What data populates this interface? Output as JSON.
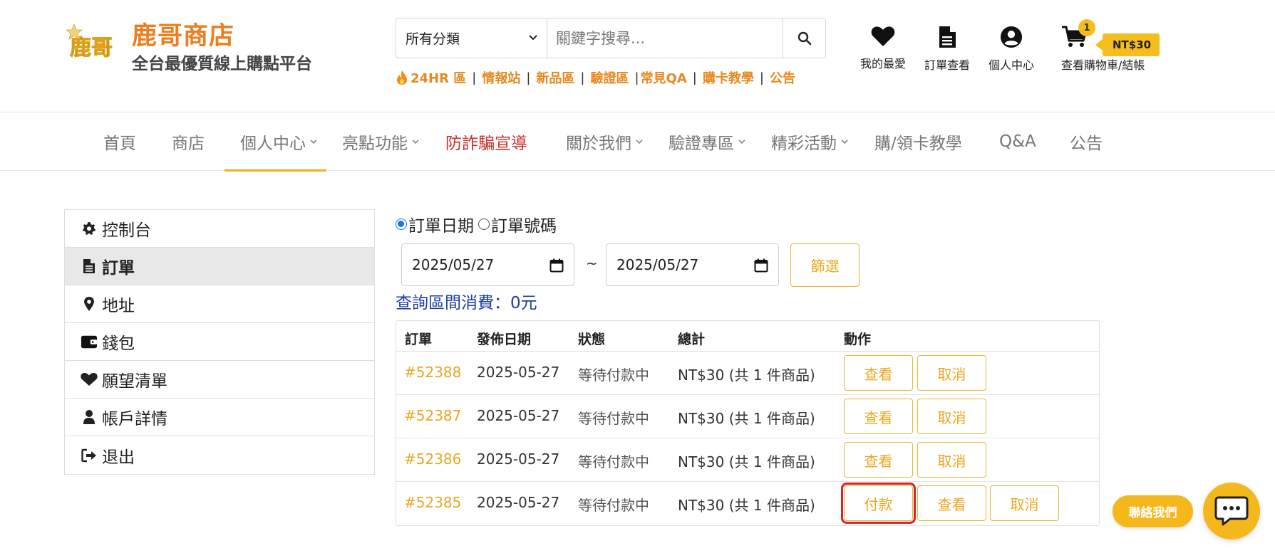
{
  "header": {
    "brand_name": "鹿哥商店",
    "brand_tagline": "全台最優質線上購點平台",
    "logo_text": "鹿哥",
    "search": {
      "category": "所有分類",
      "placeholder": "關鍵字搜尋..."
    },
    "quick_links": [
      "24HR 區",
      "情報站",
      "新品區",
      "驗證區",
      "常見QA",
      "購卡教學",
      "公告"
    ],
    "icons": {
      "favorites": "我的最愛",
      "orders": "訂單查看",
      "account": "個人中心",
      "cart": "查看購物車/結帳"
    },
    "cart_count": "1",
    "cart_total": "NT$30"
  },
  "nav": {
    "items": [
      {
        "label": "首頁"
      },
      {
        "label": "商店"
      },
      {
        "label": "個人中心"
      },
      {
        "label": "亮點功能"
      },
      {
        "label": "防詐騙宣導"
      },
      {
        "label": "關於我們"
      },
      {
        "label": "驗證專區"
      },
      {
        "label": "精彩活動"
      },
      {
        "label": "購/領卡教學"
      },
      {
        "label": "Q&A"
      },
      {
        "label": "公告"
      }
    ],
    "accent_color": "#f0b020",
    "alert_color": "#c9302c"
  },
  "sidebar": {
    "items": [
      {
        "label": "控制台",
        "icon": "gear-icon"
      },
      {
        "label": "訂單",
        "icon": "document-icon"
      },
      {
        "label": "地址",
        "icon": "map-pin-icon"
      },
      {
        "label": "錢包",
        "icon": "wallet-icon"
      },
      {
        "label": "願望清單",
        "icon": "heart-icon"
      },
      {
        "label": "帳戶詳情",
        "icon": "user-icon"
      },
      {
        "label": "退出",
        "icon": "sign-out-icon"
      }
    ],
    "active": "訂單"
  },
  "filter": {
    "radio_date": "訂單日期",
    "radio_number": "訂單號碼",
    "selected": "訂單日期",
    "date_from": "2025/05/27",
    "tilde": "~",
    "date_to": "2025/05/27",
    "button": "篩選",
    "spend_label": "查詢區間消費：",
    "spend_value": "0",
    "spend_unit": "元"
  },
  "orders": {
    "columns": [
      "訂單",
      "發佈日期",
      "狀態",
      "總計",
      "動作"
    ],
    "rows": [
      {
        "id": "#52388",
        "date": "2025-05-27",
        "status": "等待付款中",
        "total": "NT$30 (共 1 件商品)",
        "actions": [
          "查看",
          "取消"
        ]
      },
      {
        "id": "#52387",
        "date": "2025-05-27",
        "status": "等待付款中",
        "total": "NT$30 (共 1 件商品)",
        "actions": [
          "查看",
          "取消"
        ]
      },
      {
        "id": "#52386",
        "date": "2025-05-27",
        "status": "等待付款中",
        "total": "NT$30 (共 1 件商品)",
        "actions": [
          "查看",
          "取消"
        ]
      },
      {
        "id": "#52385",
        "date": "2025-05-27",
        "status": "等待付款中",
        "total": "NT$30 (共 1 件商品)",
        "actions": [
          "付款",
          "查看",
          "取消"
        ]
      }
    ]
  },
  "contact": {
    "label": "聯絡我們",
    "icon": "chat-bubble-icon"
  },
  "colors": {
    "brand_orange": "#ee7d1f",
    "gold": "#f5b81c",
    "link_blue": "#1e3fa0",
    "highlight_red": "#d9232a"
  }
}
